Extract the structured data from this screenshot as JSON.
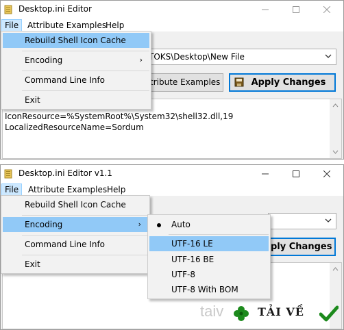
{
  "window1": {
    "title": "Desktop.ini Editor",
    "menu": {
      "file": "File",
      "attribute_examples": "Attribute Examples",
      "help": "Help"
    },
    "path_value": "TOKS\\Desktop\\New File",
    "attribute_examples_button": "tribute Examples",
    "apply_changes_button": "Apply Changes",
    "editor_lines": [
      "IconResource=%SystemRoot%\\System32\\shell32.dll,19",
      "LocalizedResourceName=Sordum"
    ],
    "file_menu": {
      "rebuild": "Rebuild Shell Icon Cache",
      "encoding": "Encoding",
      "command_line_info": "Command Line Info",
      "exit": "Exit"
    }
  },
  "window2": {
    "title": "Desktop.ini Editor v1.1",
    "menu": {
      "file": "File",
      "attribute_examples": "Attribute Examples",
      "help": "Help"
    },
    "apply_changes_button": "ply Changes",
    "file_menu": {
      "rebuild": "Rebuild Shell Icon Cache",
      "encoding": "Encoding",
      "command_line_info": "Command Line Info",
      "exit": "Exit"
    },
    "encoding_submenu": {
      "auto": "Auto",
      "utf16le": "UTF-16 LE",
      "utf16be": "UTF-16 BE",
      "utf8": "UTF-8",
      "utf8bom": "UTF-8 With BOM"
    }
  },
  "watermark": {
    "left_text": "taiv",
    "right_text": "TẢI VỀ"
  },
  "colors": {
    "menu_highlight": "#91c9f7",
    "button_focus": "#0078d7",
    "watermark_green": "#1c8a1c"
  },
  "icons": [
    "folder-icon",
    "minimize-icon",
    "maximize-icon",
    "close-icon",
    "chevron-down-icon",
    "save-icon",
    "clover-icon",
    "checkmark-icon"
  ]
}
